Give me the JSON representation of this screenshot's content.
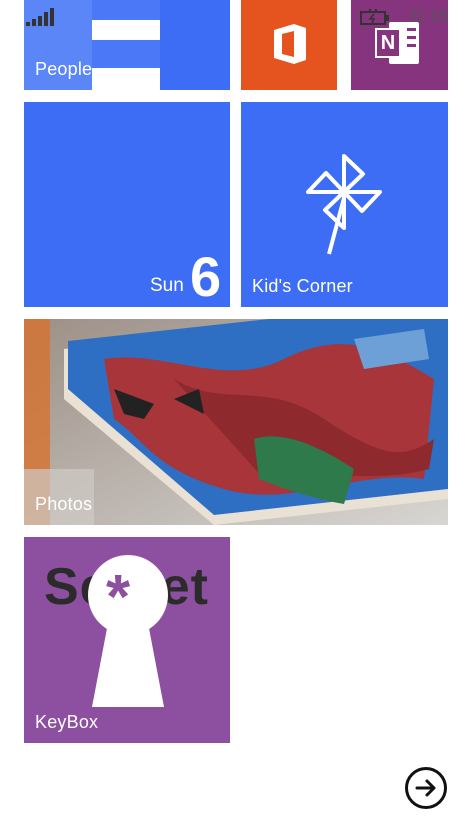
{
  "status": {
    "time": "11:15"
  },
  "tiles": {
    "people": {
      "label": "People"
    },
    "office": {
      "icon": "office-icon"
    },
    "onenote": {
      "icon": "onenote-icon",
      "glyph": "N"
    },
    "calendar": {
      "day": "Sun",
      "date": "6"
    },
    "kids_corner": {
      "label": "Kid's Corner"
    },
    "photos": {
      "label": "Photos"
    },
    "keybox": {
      "label": "KeyBox",
      "word": "Secret",
      "glyph": "*"
    }
  },
  "nav": {
    "next_icon": "arrow-right-circle-icon"
  },
  "colors": {
    "accent_blue": "#3d6df5",
    "office_orange": "#e5541e",
    "onenote_purple": "#86347d",
    "keybox_purple": "#8d4fa0"
  }
}
